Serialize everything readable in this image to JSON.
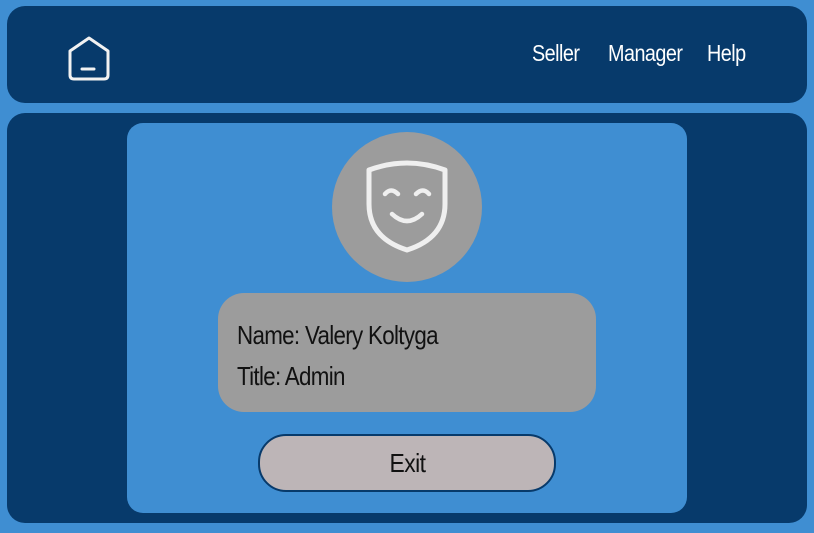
{
  "header": {
    "home_icon": "home-icon",
    "nav": {
      "seller": "Seller",
      "manager": "Manager",
      "help": "Help"
    }
  },
  "profile": {
    "avatar_icon": "smiling-mask-icon",
    "name_line": "Name: Valery Koltyga",
    "title_line": "Title: Admin",
    "exit_label": "Exit"
  },
  "colors": {
    "background": "#3f8ed2",
    "panel": "#073a6b",
    "avatar": "#9c9c9c",
    "info_box": "#9c9c9c",
    "exit_button": "#bdb5b7",
    "nav_text": "#ffffff"
  }
}
